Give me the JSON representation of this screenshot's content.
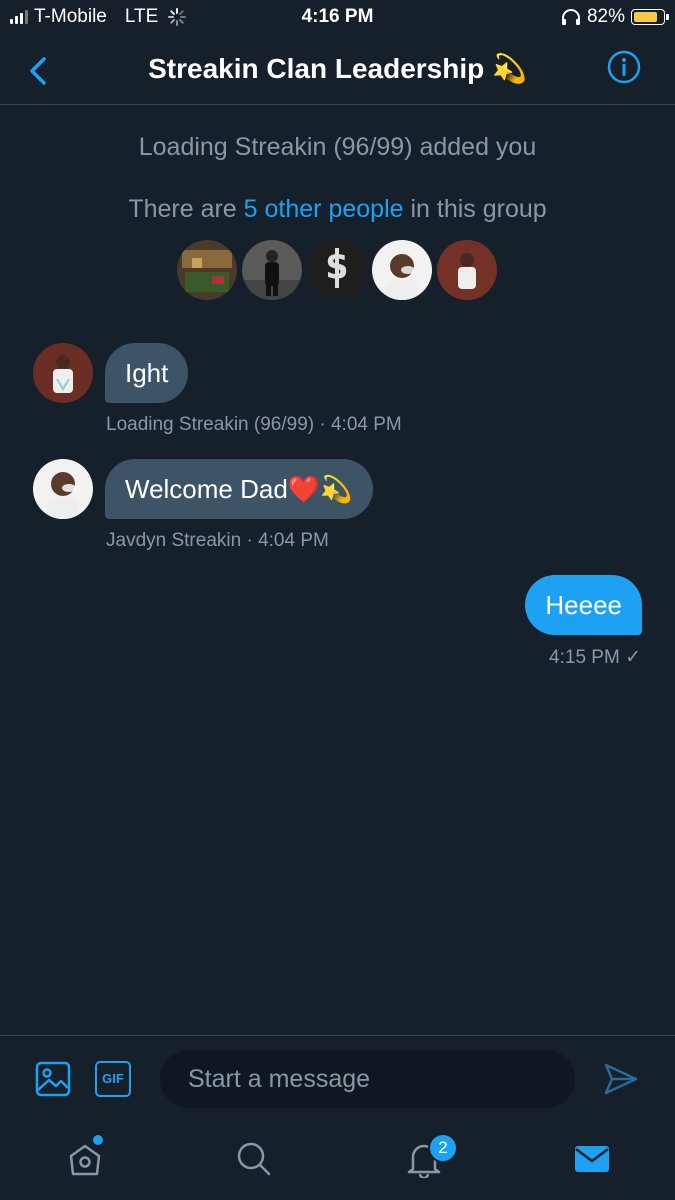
{
  "status_bar": {
    "carrier": "T-Mobile",
    "network": "LTE",
    "time": "4:16 PM",
    "battery": "82%",
    "battery_level": 0.82
  },
  "header": {
    "title": "Streakin Clan Leadership 💫"
  },
  "system": {
    "added_line": "Loading Streakin (96/99) added you",
    "group_prefix": "There are ",
    "group_link": "5 other people",
    "group_suffix": " in this group"
  },
  "messages": [
    {
      "text": "Ight",
      "sender": "Loading Streakin (96/99)",
      "time": "· 4:04 PM"
    },
    {
      "text": "Welcome Dad❤️💫",
      "sender": "Javdyn Streakin",
      "time": "· 4:04 PM"
    },
    {
      "text": "Heeee",
      "time": "4:15 PM ✓"
    }
  ],
  "compose": {
    "placeholder": "Start a message",
    "gif_label": "GIF"
  },
  "tabbar": {
    "notifications_count": "2"
  },
  "colors": {
    "background": "#15202b",
    "accent": "#1da1f2",
    "bubble_in": "#3d5466",
    "muted": "#8899a6"
  }
}
